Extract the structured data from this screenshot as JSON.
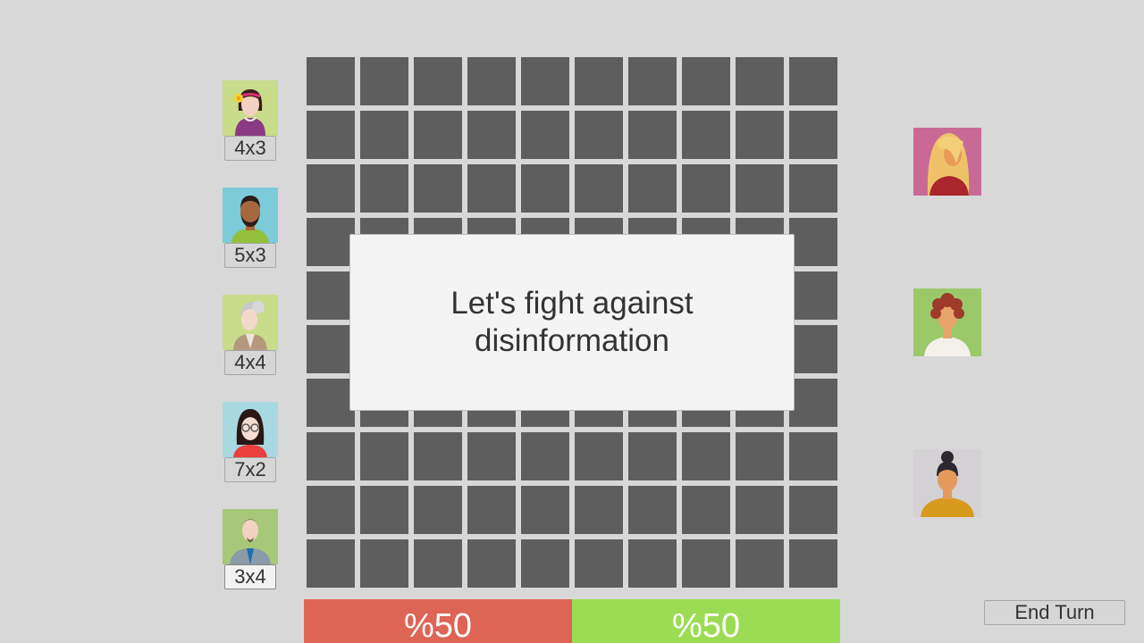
{
  "board": {
    "rows": 10,
    "cols": 10,
    "cell_color": "#5e5e5e"
  },
  "players": [
    {
      "size": "4x3",
      "avatar": "woman-flower-hair-avatar",
      "bg": "#c8dc8a"
    },
    {
      "size": "5x3",
      "avatar": "man-beard-avatar",
      "bg": "#7ccbd9"
    },
    {
      "size": "4x4",
      "avatar": "elderly-woman-avatar",
      "bg": "#c8dc8a"
    },
    {
      "size": "7x2",
      "avatar": "woman-glasses-avatar",
      "bg": "#a8d8e0"
    },
    {
      "size": "3x4",
      "avatar": "man-goatee-avatar",
      "bg": "#a7c879"
    }
  ],
  "opponents": [
    {
      "avatar": "blonde-woman-avatar",
      "bg": "#c96a96"
    },
    {
      "avatar": "curly-hair-woman-avatar",
      "bg": "#9bc96a"
    },
    {
      "avatar": "bun-hair-woman-avatar",
      "bg": "#d3d1d3"
    }
  ],
  "message": {
    "text": "Let's fight against disinformation"
  },
  "scores": {
    "left": "%50",
    "right": "%50",
    "left_color": "#de6455",
    "right_color": "#9cdc55"
  },
  "end_turn_label": "End Turn"
}
